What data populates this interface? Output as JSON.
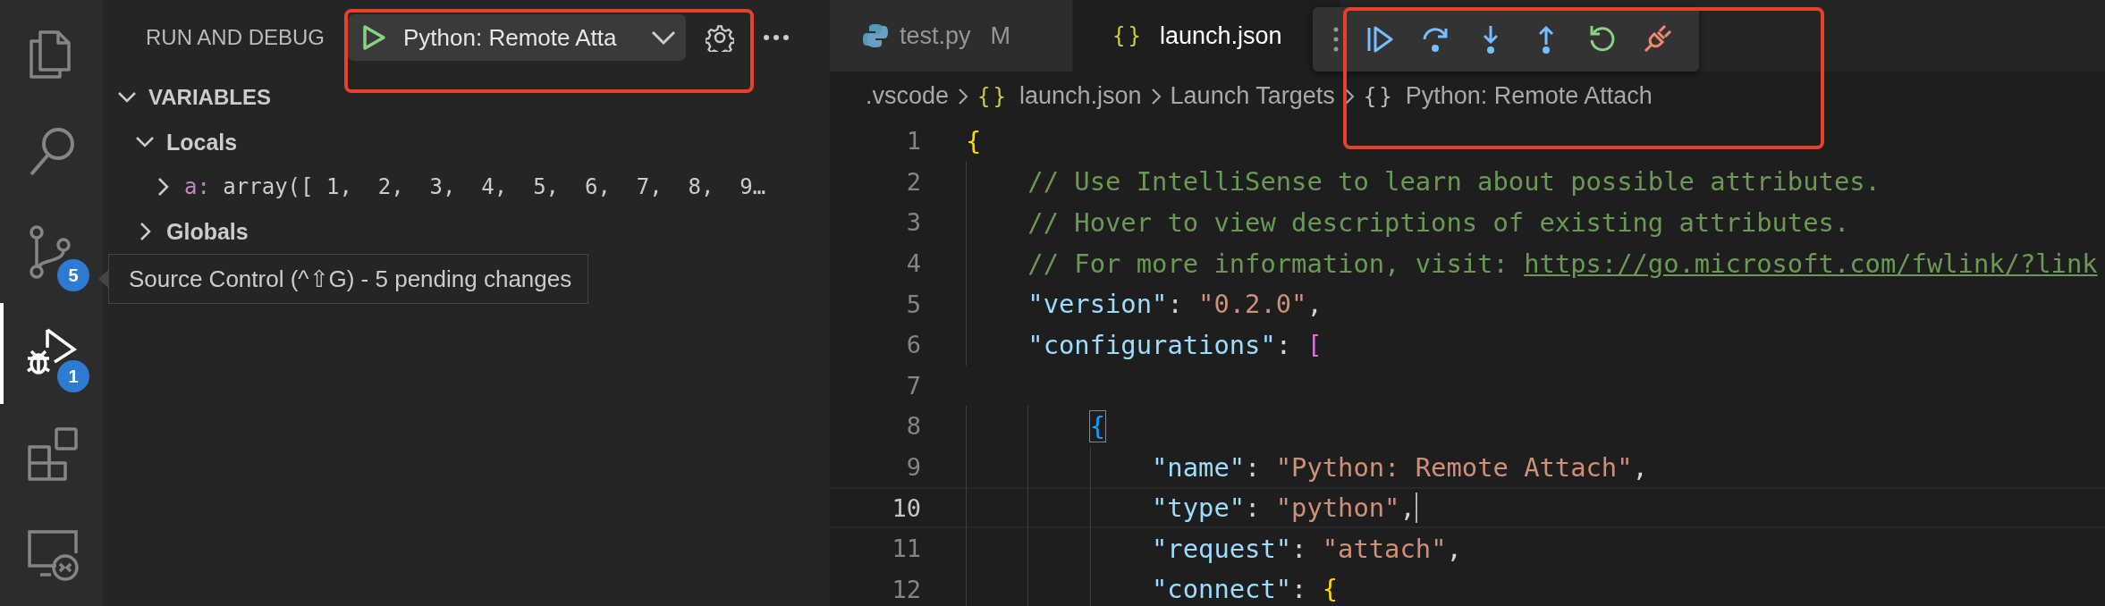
{
  "activity_bar": [
    {
      "kind": "files",
      "active": false
    },
    {
      "kind": "search",
      "active": false
    },
    {
      "kind": "source-control",
      "active": false,
      "badge": "5"
    },
    {
      "kind": "run-debug",
      "active": true,
      "badge": "1"
    },
    {
      "kind": "extensions",
      "active": false
    },
    {
      "kind": "remote",
      "active": false
    }
  ],
  "sidebar": {
    "title": "RUN AND DEBUG",
    "config": "Python: Remote Atta",
    "sections": [
      {
        "label": "VARIABLES",
        "expanded": true,
        "children": [
          {
            "label": "Locals",
            "expanded": true,
            "children": [
              {
                "name": "a:",
                "value": "array([ 1,  2,  3,  4,  5,  6,  7,  8,  9…",
                "expanded": false
              }
            ]
          },
          {
            "label": "Globals",
            "expanded": false
          }
        ]
      }
    ]
  },
  "tooltip": {
    "text": "Source Control (^⇧G) - 5 pending changes"
  },
  "tabs": [
    {
      "kind": "python",
      "label": "test.py",
      "badge": "M",
      "selected": false
    },
    {
      "kind": "json",
      "icon": "{}",
      "label": "launch.json",
      "selected": true
    }
  ],
  "debug_toolbar": [
    {
      "kind": "continue"
    },
    {
      "kind": "step-over"
    },
    {
      "kind": "step-into"
    },
    {
      "kind": "step-out"
    },
    {
      "kind": "restart"
    },
    {
      "kind": "disconnect"
    }
  ],
  "breadcrumbs": [
    {
      "label": ".vscode"
    },
    {
      "icon": "{}",
      "label": "launch.json"
    },
    {
      "label": "Launch Targets"
    },
    {
      "icon": "{}",
      "label": "Python: Remote Attach"
    }
  ],
  "code": [
    {
      "num": "1",
      "current": false,
      "tokens": [
        {
          "kind": "brace",
          "text": "{"
        }
      ]
    },
    {
      "num": "2",
      "current": false,
      "tokens": [
        {
          "kind": "comment",
          "text": "    // Use IntelliSense to learn about possible attributes."
        }
      ]
    },
    {
      "num": "3",
      "current": false,
      "tokens": [
        {
          "kind": "comment",
          "text": "    // Hover to view descriptions of existing attributes."
        }
      ]
    },
    {
      "num": "4",
      "current": false,
      "tokens": [
        {
          "kind": "comment",
          "text": "    // For more information, visit: "
        },
        {
          "kind": "link",
          "text": "https://go.microsoft.com/fwlink/?link"
        }
      ]
    },
    {
      "num": "5",
      "current": false,
      "tokens": [
        {
          "kind": "key",
          "text": "    \"version\""
        },
        {
          "kind": "punct",
          "text": ": "
        },
        {
          "kind": "string",
          "text": "\"0.2.0\""
        },
        {
          "kind": "punct",
          "text": ","
        }
      ]
    },
    {
      "num": "6",
      "current": false,
      "tokens": [
        {
          "kind": "key",
          "text": "    \"configurations\""
        },
        {
          "kind": "punct",
          "text": ": "
        },
        {
          "kind": "bracket",
          "text": "["
        }
      ]
    },
    {
      "num": "7",
      "current": false
    },
    {
      "num": "8",
      "current": false,
      "tokens": [
        {
          "kind": "brace2",
          "text": "        {",
          "matched": true
        }
      ]
    },
    {
      "num": "9",
      "current": false,
      "tokens": [
        {
          "kind": "key",
          "text": "            \"name\""
        },
        {
          "kind": "punct",
          "text": ": "
        },
        {
          "kind": "string",
          "text": "\"Python: Remote Attach\""
        },
        {
          "kind": "punct",
          "text": ","
        }
      ]
    },
    {
      "num": "10",
      "current": true,
      "tokens": [
        {
          "kind": "key",
          "text": "            \"type\""
        },
        {
          "kind": "punct",
          "text": ": "
        },
        {
          "kind": "string",
          "text": "\"python\""
        },
        {
          "kind": "punct",
          "text": ","
        }
      ]
    },
    {
      "num": "11",
      "current": false,
      "tokens": [
        {
          "kind": "key",
          "text": "            \"request\""
        },
        {
          "kind": "punct",
          "text": ": "
        },
        {
          "kind": "string",
          "text": "\"attach\""
        },
        {
          "kind": "punct",
          "text": ","
        }
      ]
    },
    {
      "num": "12",
      "current": false,
      "tokens": [
        {
          "kind": "key",
          "text": "            \"connect\""
        },
        {
          "kind": "punct",
          "text": ": "
        },
        {
          "kind": "brace",
          "text": "{"
        }
      ]
    }
  ],
  "annotations": [
    {
      "color": "#e8402a"
    },
    {
      "color": "#e8402a"
    }
  ]
}
